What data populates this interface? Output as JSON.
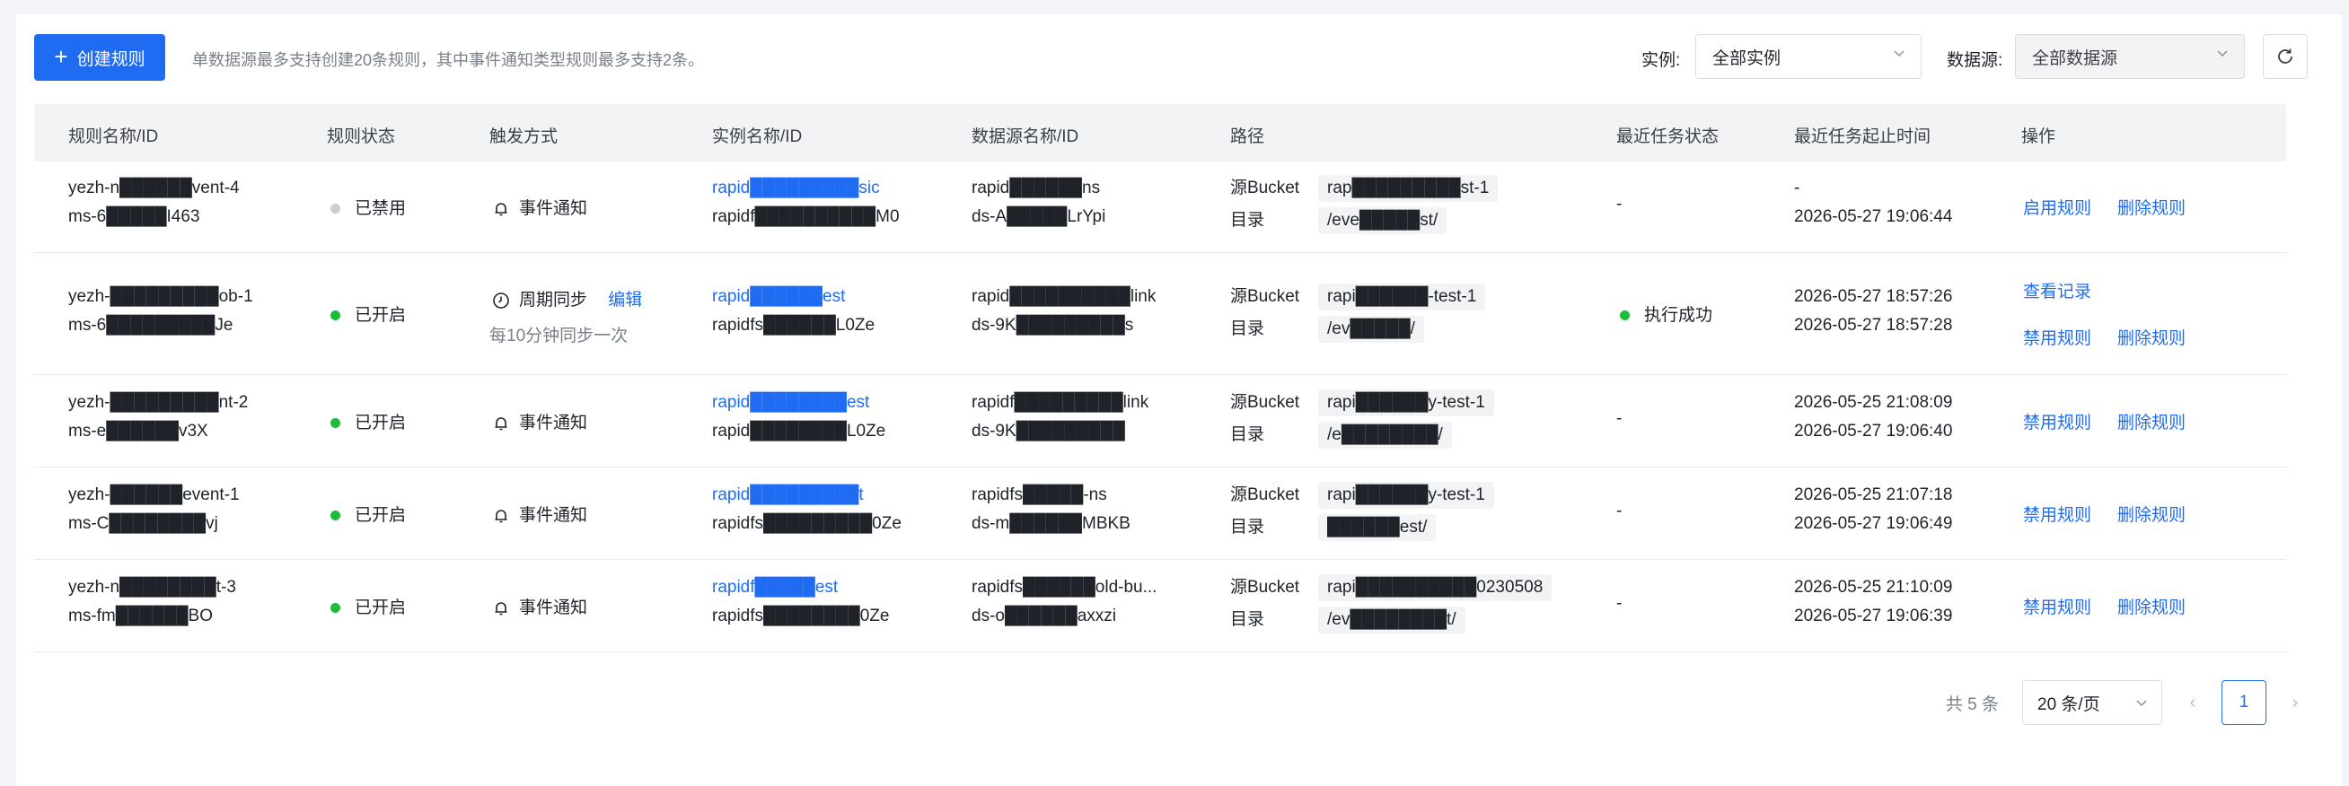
{
  "toolbar": {
    "create_label": "创建规则",
    "hint": "单数据源最多支持创建20条规则，其中事件通知类型规则最多支持2条。",
    "instance_label": "实例:",
    "instance_value": "全部实例",
    "datasource_label": "数据源:",
    "datasource_value": "全部数据源"
  },
  "table": {
    "headers": [
      "规则名称/ID",
      "规则状态",
      "触发方式",
      "实例名称/ID",
      "数据源名称/ID",
      "路径",
      "最近任务状态",
      "最近任务起止时间",
      "操作"
    ],
    "path_labels": {
      "bucket": "源Bucket",
      "dir": "目录"
    },
    "rows": [
      {
        "name": "yezh-n██████vent-4",
        "id": "ms-6█████I463",
        "status": "已禁用",
        "trigger": "事件通知",
        "instance_name": "rapid█████████sic",
        "instance_id": "rapidf██████████M0",
        "ds_name": "rapid██████ns",
        "ds_id": "ds-A█████LrYpi",
        "bucket": "rap█████████st-1",
        "dir": "/eve█████st/",
        "task_status": "-",
        "time_start": "-",
        "time_end": "2026-05-27 19:06:44",
        "actions": [
          "启用规则",
          "删除规则"
        ]
      },
      {
        "name": "yezh-█████████ob-1",
        "id": "ms-6█████████Je",
        "status": "已开启",
        "trigger": "周期同步",
        "trigger_edit": "编辑",
        "trigger_sub": "每10分钟同步一次",
        "instance_name": "rapid██████est",
        "instance_id": "rapidfs██████L0Ze",
        "ds_name": "rapid██████████link",
        "ds_id": "ds-9K█████████s",
        "bucket": "rapi██████-test-1",
        "dir": "/ev█████/",
        "task_status": "执行成功",
        "time_start": "2026-05-27 18:57:26",
        "time_end": "2026-05-27 18:57:28",
        "actions": [
          "查看记录",
          "禁用规则",
          "删除规则"
        ]
      },
      {
        "name": "yezh-█████████nt-2",
        "id": "ms-e██████v3X",
        "status": "已开启",
        "trigger": "事件通知",
        "instance_name": "rapid████████est",
        "instance_id": "rapid████████L0Ze",
        "ds_name": "rapidf█████████link",
        "ds_id": "ds-9K█████████",
        "bucket": "rapi██████y-test-1",
        "dir": "/e████████/",
        "task_status": "-",
        "time_start": "2026-05-25 21:08:09",
        "time_end": "2026-05-27 19:06:40",
        "actions": [
          "禁用规则",
          "删除规则"
        ]
      },
      {
        "name": "yezh-██████event-1",
        "id": "ms-C████████vj",
        "status": "已开启",
        "trigger": "事件通知",
        "instance_name": "rapid█████████t",
        "instance_id": "rapidfs█████████0Ze",
        "ds_name": "rapidfs█████-ns",
        "ds_id": "ds-m██████MBKB",
        "bucket": "rapi██████y-test-1",
        "dir": "██████est/",
        "task_status": "-",
        "time_start": "2026-05-25 21:07:18",
        "time_end": "2026-05-27 19:06:49",
        "actions": [
          "禁用规则",
          "删除规则"
        ]
      },
      {
        "name": "yezh-n████████t-3",
        "id": "ms-fm██████BO",
        "status": "已开启",
        "trigger": "事件通知",
        "instance_name": "rapidf█████est",
        "instance_id": "rapidfs████████0Ze",
        "ds_name": "rapidfs██████old-bu...",
        "ds_id": "ds-o██████axxzi",
        "bucket": "rapi██████████0230508",
        "dir": "/ev████████t/",
        "task_status": "-",
        "time_start": "2026-05-25 21:10:09",
        "time_end": "2026-05-27 19:06:39",
        "actions": [
          "禁用规则",
          "删除规则"
        ]
      }
    ]
  },
  "pagination": {
    "total": "共 5 条",
    "page_size": "20 条/页",
    "current_page": "1"
  },
  "colors": {
    "primary": "#1f6cf2",
    "success": "#1ebc3a",
    "disabled": "#c9cdd4"
  }
}
